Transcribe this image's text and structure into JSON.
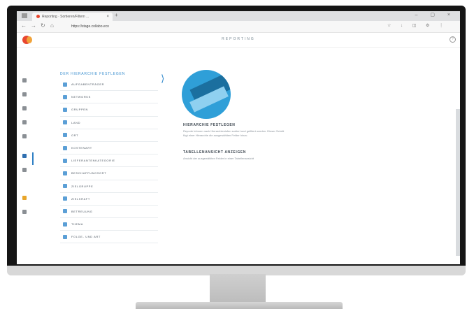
{
  "browser": {
    "tab_title": "Reporting · Sortieren/Filtern ...",
    "tab_close": "×",
    "new_tab": "+",
    "window_controls": "– ▢ ×",
    "back": "←",
    "forward": "→",
    "reload": "↻",
    "home": "⌂",
    "url": "https://stage.collabo.eco",
    "toolbar_icons": "☆ ↓ ◫ ⚙ ⋮"
  },
  "app": {
    "title": "REPORTING",
    "help": "?"
  },
  "side_menu": {
    "heading": "DER HIERARCHIE FESTLEGEN",
    "items": [
      {
        "label": "AUFGABENTRÄGER"
      },
      {
        "label": "NETWORKS"
      },
      {
        "label": "GRUPPEN"
      },
      {
        "label": "LAND"
      },
      {
        "label": "ORT"
      },
      {
        "label": "KOSTENART"
      },
      {
        "label": "LIEFERANTENKATEGORIE"
      },
      {
        "label": "BESCHAFFUNGSORT"
      },
      {
        "label": "ZIELGRUPPE"
      },
      {
        "label": "ZIELKRAFT"
      },
      {
        "label": "BETREUUNG"
      },
      {
        "label": "THEMA"
      },
      {
        "label": "FOLGE- UND ART"
      }
    ]
  },
  "info": {
    "heading1": "HIERARCHIE FESTLEGEN",
    "text1": "Reporte können nach Hierarchiestufen sortiert und gefiltert werden. Dieser Schritt fügt einer Hierarchie die ausgewählten Felder hinzu.",
    "heading2": "TABELLENANSICHT ANZEIGEN",
    "text2": "Ansicht der ausgewählten Felder in einer Tabellenansicht"
  },
  "colors": {
    "accent": "#3b8fcf",
    "brand": "#e8472f",
    "brand_secondary": "#f1a33a"
  }
}
